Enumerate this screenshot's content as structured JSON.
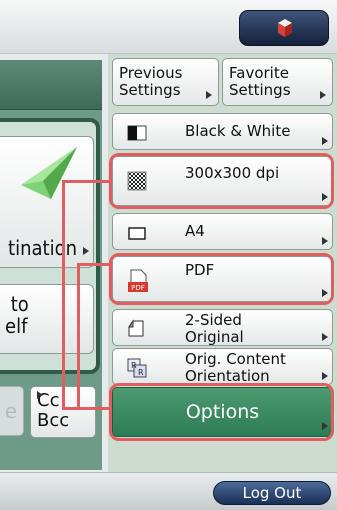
{
  "left_panel": {
    "destination_label": "tination",
    "to_myself_label": " to\nelf",
    "dim_button_label": "e",
    "cc_bcc_label": "Cc\nBcc"
  },
  "settings": {
    "previous_label": "Previous\nSettings",
    "favorite_label": "Favorite\nSettings",
    "color_mode": "Black & White",
    "resolution": "300x300 dpi",
    "paper_size": "A4",
    "file_format": "PDF",
    "sided": "2-Sided\nOriginal",
    "orientation": "Orig. Content\nOrientation",
    "options_label": "Options"
  },
  "footer": {
    "logout_label": "Log Out"
  },
  "colors": {
    "highlight": "#e05d60",
    "options_green": "#3a8a61",
    "logout_navy": "#1f3a66"
  }
}
